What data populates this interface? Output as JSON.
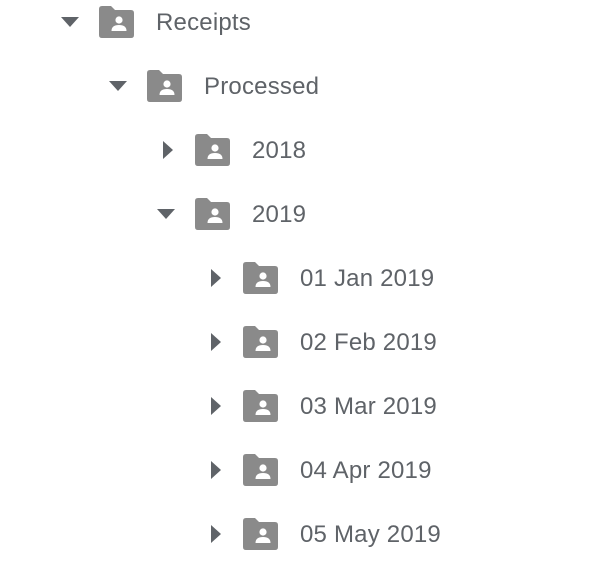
{
  "colors": {
    "text": "#5f6368",
    "folder": "#8a8a8a",
    "arrow": "#5f6368"
  },
  "icons": {
    "expanded": "triangle-down-icon",
    "collapsed": "triangle-right-icon",
    "folder": "shared-folder-icon"
  },
  "tree": {
    "receipts": {
      "label": "Receipts",
      "expanded": true
    },
    "processed": {
      "label": "Processed",
      "expanded": true
    },
    "y2018": {
      "label": "2018",
      "expanded": false
    },
    "y2019": {
      "label": "2019",
      "expanded": true
    },
    "months": [
      {
        "label": "01 Jan 2019",
        "expanded": false
      },
      {
        "label": "02 Feb 2019",
        "expanded": false
      },
      {
        "label": "03 Mar 2019",
        "expanded": false
      },
      {
        "label": "04 Apr 2019",
        "expanded": false
      },
      {
        "label": "05 May 2019",
        "expanded": false
      }
    ]
  }
}
